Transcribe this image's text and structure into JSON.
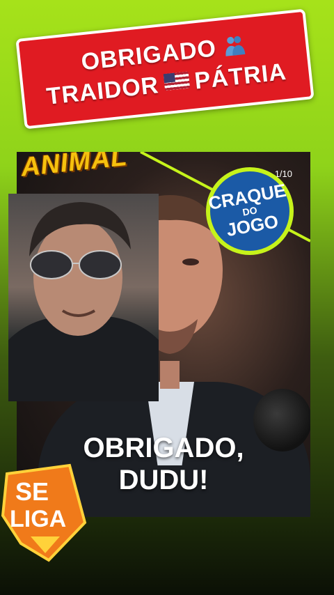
{
  "banner": {
    "line1": "OBRIGADO",
    "line2_left": "TRAIDOR",
    "line2_right": "PÁTRIA",
    "people_icon": "people-hugging-icon",
    "flag_icon": "us-flag-icon"
  },
  "post": {
    "sticker_text": "ANIMAL",
    "counter": "1/10",
    "badge": {
      "top": "CRAQUE",
      "middle": "DO",
      "bottom": "JOGO"
    },
    "caption_line1": "OBRIGADO,",
    "caption_line2": "DUDU!"
  },
  "sticker": {
    "line1": "SE",
    "line2": "LIGA"
  },
  "colors": {
    "background_top": "#a6e21a",
    "background_bottom": "#0b1006",
    "banner_red": "#e01b22",
    "badge_blue": "#1b5aa6",
    "badge_ring": "#c6f31b",
    "sticker_orange": "#f07a1a",
    "animal_yellow": "#f6c10e"
  }
}
